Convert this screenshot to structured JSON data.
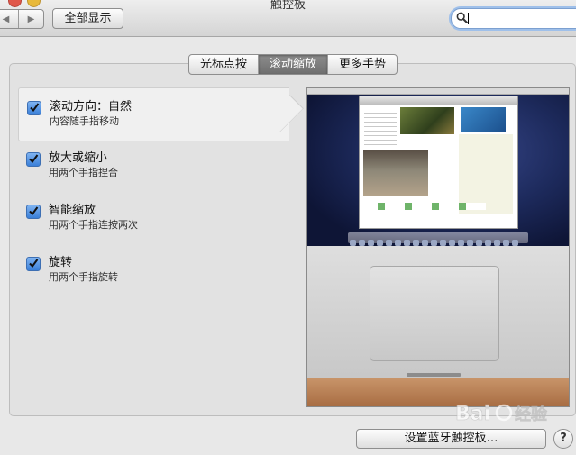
{
  "window": {
    "title": "触控板"
  },
  "toolbar": {
    "back_glyph": "◀",
    "forward_glyph": "▶",
    "show_all_label": "全部显示",
    "search": {
      "value": "",
      "icon": "magnifier-icon"
    }
  },
  "tabs": [
    {
      "label": "光标点按",
      "active": false
    },
    {
      "label": "滚动缩放",
      "active": true
    },
    {
      "label": "更多手势",
      "active": false
    }
  ],
  "options": [
    {
      "title": "滚动方向：自然",
      "subtitle": "内容随手指移动",
      "checked": true,
      "selected": true
    },
    {
      "title": "放大或缩小",
      "subtitle": "用两个手指捏合",
      "checked": true,
      "selected": false
    },
    {
      "title": "智能缩放",
      "subtitle": "用两个手指连按两次",
      "checked": true,
      "selected": false
    },
    {
      "title": "旋转",
      "subtitle": "用两个手指旋转",
      "checked": true,
      "selected": false
    }
  ],
  "bottom": {
    "bluetooth_button_label": "设置蓝牙触控板…",
    "help_label": "?"
  },
  "colors": {
    "checkbox_blue": "#3a7fd8",
    "tab_active": "#7a7a7a"
  }
}
